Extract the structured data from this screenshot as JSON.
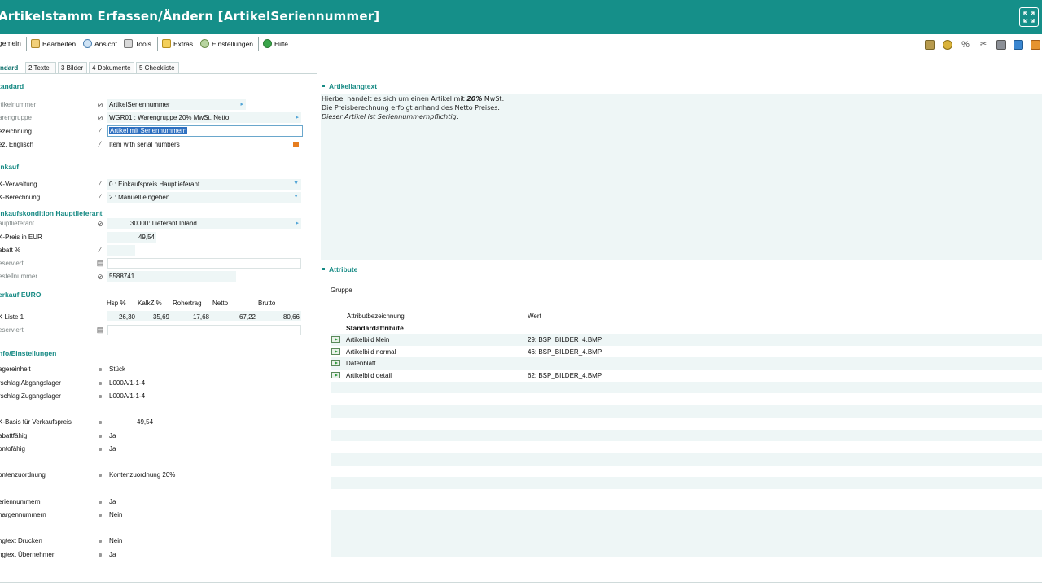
{
  "window": {
    "title": "Artikelstamm Erfassen/Ändern [ArtikelSeriennummer]"
  },
  "menu": {
    "items": [
      {
        "label": "gemein",
        "icon": "none"
      },
      {
        "label": "Bearbeiten",
        "icon": "edit-icon"
      },
      {
        "label": "Ansicht",
        "icon": "view-icon"
      },
      {
        "label": "Tools",
        "icon": "tools-icon"
      },
      {
        "label": "Extras",
        "icon": "folder-icon"
      },
      {
        "label": "Einstellungen",
        "icon": "settings-icon"
      },
      {
        "label": "Hilfe",
        "icon": "help-icon"
      }
    ],
    "right_icons": [
      "database-icon",
      "money-bag-icon",
      "percent-icon",
      "tools-small-icon",
      "printer-icon",
      "transfer-icon",
      "book-icon"
    ]
  },
  "tabs": [
    {
      "label": "ndard",
      "active": true
    },
    {
      "label": "2 Texte",
      "active": false
    },
    {
      "label": "3 Bilder",
      "active": false
    },
    {
      "label": "4 Dokumente",
      "active": false
    },
    {
      "label": "5 Checkliste",
      "active": false
    }
  ],
  "standard": {
    "section": "tandard",
    "artikelnummer": {
      "label": "rtikelnummer",
      "value": "ArtikelSeriennummer"
    },
    "warengruppe": {
      "label": "arengruppe",
      "value": "WGR01 : Warengruppe 20% MwSt. Netto"
    },
    "bezeichnung": {
      "label": "ezeichnung",
      "value": "Artikel mit Seriennummern"
    },
    "bez_englisch": {
      "label": "ez. Englisch",
      "value": "Item with serial numbers"
    }
  },
  "einkauf": {
    "section": "inkauf",
    "ek_verwaltung": {
      "label": "K-Verwaltung",
      "value": "0 : Einkaufspreis Hauptlieferant"
    },
    "ek_berechnung": {
      "label": "K-Berechnung",
      "value": "2 : Manuell eingeben"
    }
  },
  "einkaufskondition": {
    "section": "inkaufskondition Hauptlieferant",
    "hauptlieferant": {
      "label": "auptlieferant",
      "value": "30000: Lieferant Inland"
    },
    "ek_preis": {
      "label": "K-Preis in EUR",
      "value": "49,54"
    },
    "rabatt": {
      "label": "abatt %",
      "value": ""
    },
    "reserviert": {
      "label": "eserviert",
      "value": ""
    },
    "bestellnummer": {
      "label": "estellnummer",
      "value": "5588741"
    }
  },
  "verkauf": {
    "section": "erkauf EURO",
    "columns": [
      "Hsp %",
      "KalkZ %",
      "Rohertrag",
      "Netto",
      "Brutto"
    ],
    "liste1": {
      "label": "K Liste 1",
      "values": [
        "26,30",
        "35,69",
        "17,68",
        "67,22",
        "80,66"
      ]
    },
    "reserviert": {
      "label": "eserviert",
      "value": ""
    }
  },
  "info": {
    "section": "nfo/Einstellungen",
    "rows": [
      {
        "label": "agereinheit",
        "value": "Stück"
      },
      {
        "label": "rschlag Abgangslager",
        "value": "L000A/1-1-4"
      },
      {
        "label": "rschlag Zugangslager",
        "value": "L000A/1-1-4"
      },
      {
        "label": "K-Basis für Verkaufspreis",
        "value": "49,54"
      },
      {
        "label": "abattfähig",
        "value": "Ja"
      },
      {
        "label": "ontofähig",
        "value": "Ja"
      },
      {
        "label": "ontenzuordnung",
        "value": "Kontenzuordnung 20%"
      },
      {
        "label": "eriennummern",
        "value": "Ja"
      },
      {
        "label": "hargennummern",
        "value": "Nein"
      },
      {
        "label": "ngtext Drucken",
        "value": "Nein"
      },
      {
        "label": "ngtext Übernehmen",
        "value": "Ja"
      }
    ]
  },
  "longtext": {
    "title": "Artikellangtext",
    "line1_prefix": "Hierbei handelt es sich um einen Artikel mit ",
    "line1_bold": "20%",
    "line1_suffix": " MwSt.",
    "line2": "Die Preisberechnung erfolgt anhand des Netto Preises.",
    "line3": "Dieser Artikel ist Seriennummernpflichtig."
  },
  "attribute": {
    "title": "Attribute",
    "gruppe_label": "Gruppe",
    "col_name": "Attributbezeichnung",
    "col_value": "Wert",
    "group_title": "Standardattribute",
    "rows": [
      {
        "name": "Artikelbild klein",
        "value": "29: BSP_BILDER_4.BMP",
        "icon": true
      },
      {
        "name": "Artikelbild normal",
        "value": "46: BSP_BILDER_4.BMP",
        "icon": true
      },
      {
        "name": "Datenblatt",
        "value": "",
        "icon": true
      },
      {
        "name": "Artikelbild detail",
        "value": "62: BSP_BILDER_4.BMP",
        "icon": true
      }
    ]
  }
}
